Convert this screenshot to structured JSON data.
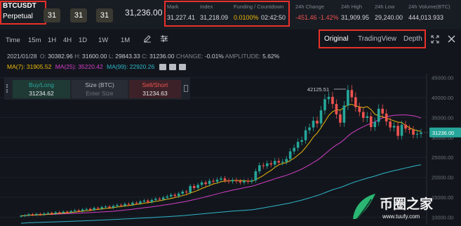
{
  "header": {
    "symbol": "BTCUSDT",
    "contract": "Perpetual",
    "leverage_tabs": [
      "31",
      "31",
      "31"
    ],
    "last_price": "31,236.00",
    "stats": [
      {
        "label": "Mark",
        "value": "31,227.41"
      },
      {
        "label": "Index",
        "value": "31,218.09"
      },
      {
        "label": "Funding / Countdown",
        "value": "0.0100%",
        "value2": "02:42:50"
      },
      {
        "label": "24h Change",
        "value": "-451.46 -1.42%"
      },
      {
        "label": "24h High",
        "value": "31,909.95"
      },
      {
        "label": "24h Low",
        "value": "29,240.00"
      },
      {
        "label": "24h Volume(BTC)",
        "value": "444,013.933"
      }
    ]
  },
  "toolbar": {
    "time_label": "Time",
    "intervals": [
      "15m",
      "1H",
      "4H",
      "1D",
      "1W",
      "1M"
    ],
    "view_tabs": [
      "Original",
      "TradingView",
      "Depth"
    ],
    "active_view": "Original"
  },
  "ohlc": {
    "date": "2021/01/28",
    "open_label": "O:",
    "open": "30382.96",
    "high_label": "H:",
    "high": "31600.00",
    "low_label": "L:",
    "low": "29843.33",
    "close_label": "C:",
    "close": "31236.00",
    "change_label": "CHANGE:",
    "change": "-0.01%",
    "amp_label": "AMPLITUDE:",
    "amp": "5.62%"
  },
  "ma": {
    "ma7_label": "MA(7):",
    "ma7": "31905.52",
    "ma25_label": "MA(25):",
    "ma25": "35220.42",
    "ma99_label": "MA(99):",
    "ma99": "22920.26"
  },
  "order_panel": {
    "buy_label": "Buy/Long",
    "buy_price": "31234.62",
    "size_label": "Size (BTC)",
    "size_placeholder": "Enter Size",
    "sell_label": "Sell/Short",
    "sell_price": "31234.63"
  },
  "chart_labels": {
    "high_marker": "42125.51",
    "current_price_tag": "31236.00"
  },
  "watermark": {
    "title": "币圈之家",
    "url": "www.tuufy.com"
  },
  "colors": {
    "up": "#26a69a",
    "down": "#ef5350",
    "ma7": "#f0b90b",
    "ma25": "#d63dc8",
    "ma99": "#2fb5c9",
    "highlight_box": "#e8302a"
  },
  "chart_data": {
    "type": "candlestick",
    "y_ticks": [
      5000,
      10000,
      15000,
      20000,
      25000,
      30000,
      35000,
      40000,
      45000
    ],
    "ylim": [
      9000,
      46000
    ],
    "candles_close": [
      10300,
      10450,
      10700,
      10550,
      10800,
      10650,
      10900,
      11050,
      10850,
      11200,
      11100,
      11350,
      11250,
      11500,
      11700,
      11550,
      11900,
      12050,
      11800,
      12300,
      12150,
      12500,
      12650,
      12400,
      12800,
      13050,
      12900,
      13300,
      13150,
      13600,
      13450,
      13900,
      14150,
      13800,
      14300,
      14600,
      14450,
      14900,
      15200,
      15600,
      15300,
      15900,
      16400,
      16200,
      17800,
      17300,
      18100,
      18700,
      18300,
      19100,
      18900,
      19400,
      19700,
      19200,
      18950,
      19300,
      19000,
      18700,
      19100,
      18900,
      19200,
      21500,
      23000,
      22800,
      23500,
      23200,
      24100,
      23700,
      23900,
      24600,
      26500,
      27400,
      28900,
      29300,
      31800,
      32500,
      34200,
      33500,
      36800,
      39600,
      40200,
      38400,
      35800,
      33700,
      38000,
      41900,
      40100,
      37600,
      36400,
      34900,
      35300,
      32600,
      33900,
      37200,
      36000,
      34000,
      32500,
      32900,
      30400,
      33200,
      32200,
      31900,
      30700,
      30900,
      31236
    ],
    "high_marker_value": 42125.51,
    "last_value": 31236.0
  }
}
